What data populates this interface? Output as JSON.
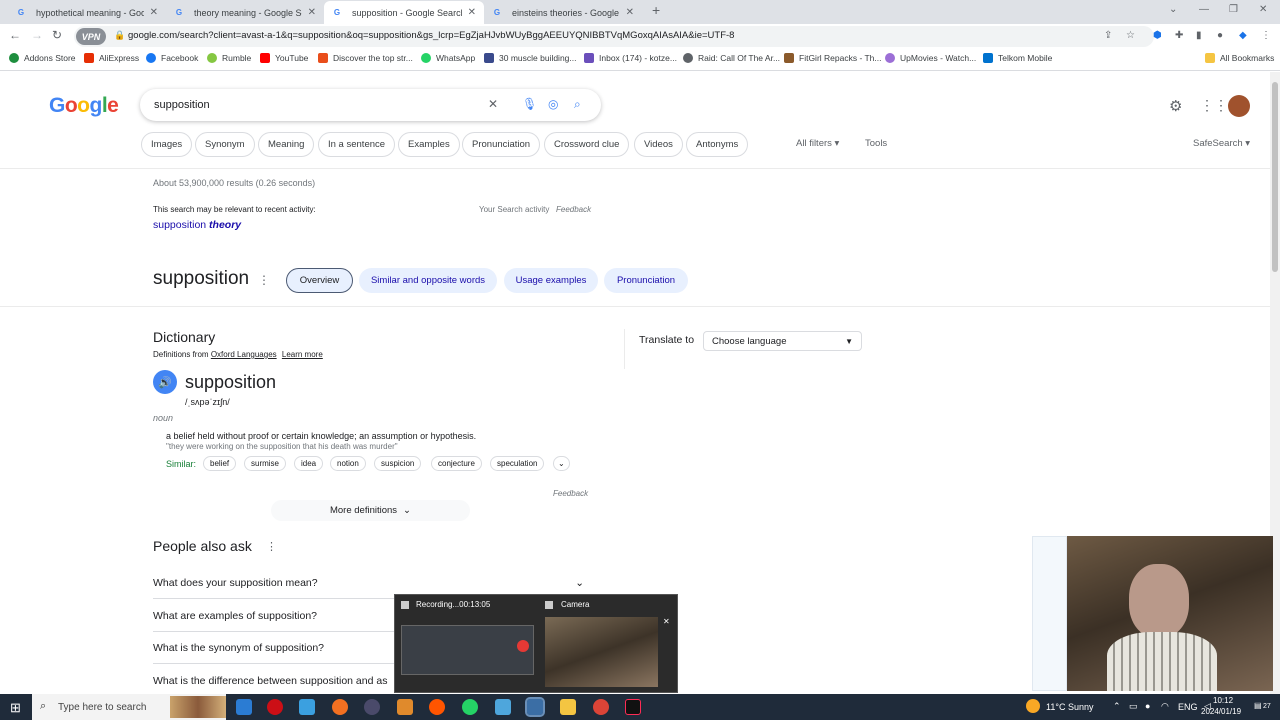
{
  "browser": {
    "tabs": [
      {
        "title": "hypothetical meaning - Google"
      },
      {
        "title": "theory meaning - Google Searc"
      },
      {
        "title": "supposition - Google Search"
      },
      {
        "title": "einsteins theories - Google Sea"
      }
    ],
    "url": "google.com/search?client=avast-a-1&q=supposition&oq=supposition&gs_lcrp=EgZjaHJvbWUyBggAEEUYQNIBBTVqMGoxqAIAsAIA&ie=UTF-8",
    "vpn_badge": "VPN",
    "bookmarks": [
      "Addons Store",
      "AliExpress",
      "Facebook",
      "Rumble",
      "YouTube",
      "Discover the top str...",
      "WhatsApp",
      "30 muscle building...",
      "Inbox (174) - kotze...",
      "Raid: Call Of The Ar...",
      "FitGirl Repacks - Th...",
      "UpMovies - Watch...",
      "Telkom Mobile"
    ],
    "all_bookmarks": "All Bookmarks"
  },
  "search": {
    "query": "supposition",
    "chips": [
      "Images",
      "Synonym",
      "Meaning",
      "In a sentence",
      "Examples",
      "Pronunciation",
      "Crossword clue",
      "Videos",
      "Antonyms"
    ],
    "all_filters": "All filters",
    "tools": "Tools",
    "safesearch": "SafeSearch",
    "result_stats": "About 53,900,000 results (0.26 seconds)",
    "recent_note": "This search may be relevant to recent activity:",
    "your_activity": "Your Search activity",
    "feedback": "Feedback",
    "suggest_word": "supposition",
    "suggest_bold": "theory"
  },
  "entity": {
    "title": "supposition",
    "tabs": [
      "Overview",
      "Similar and opposite words",
      "Usage examples",
      "Pronunciation"
    ]
  },
  "dictionary": {
    "heading": "Dictionary",
    "source_prefix": "Definitions from",
    "source": "Oxford Languages",
    "learn_more": "Learn more",
    "word": "supposition",
    "phonetic": "/ˌsʌpəˈzɪʃn/",
    "pos": "noun",
    "definition": "a belief held without proof or certain knowledge; an assumption or hypothesis.",
    "example": "\"they were working on the supposition that his death was murder\"",
    "similar_label": "Similar:",
    "similar": [
      "belief",
      "surmise",
      "idea",
      "notion",
      "suspicion",
      "conjecture",
      "speculation"
    ],
    "feedback": "Feedback",
    "more": "More definitions"
  },
  "translate": {
    "label": "Translate to",
    "placeholder": "Choose language"
  },
  "paa": {
    "title": "People also ask",
    "questions": [
      "What does your supposition mean?",
      "What are examples of supposition?",
      "What is the synonym of supposition?",
      "What is the difference between supposition and as"
    ]
  },
  "recorder": {
    "title": "Recording...00:13:05",
    "camera": "Camera"
  },
  "taskbar": {
    "search_placeholder": "Type here to search",
    "weather": "11°C  Sunny",
    "lang": "ENG",
    "time": "10:12",
    "date": "2024/01/19",
    "notif": "27"
  }
}
